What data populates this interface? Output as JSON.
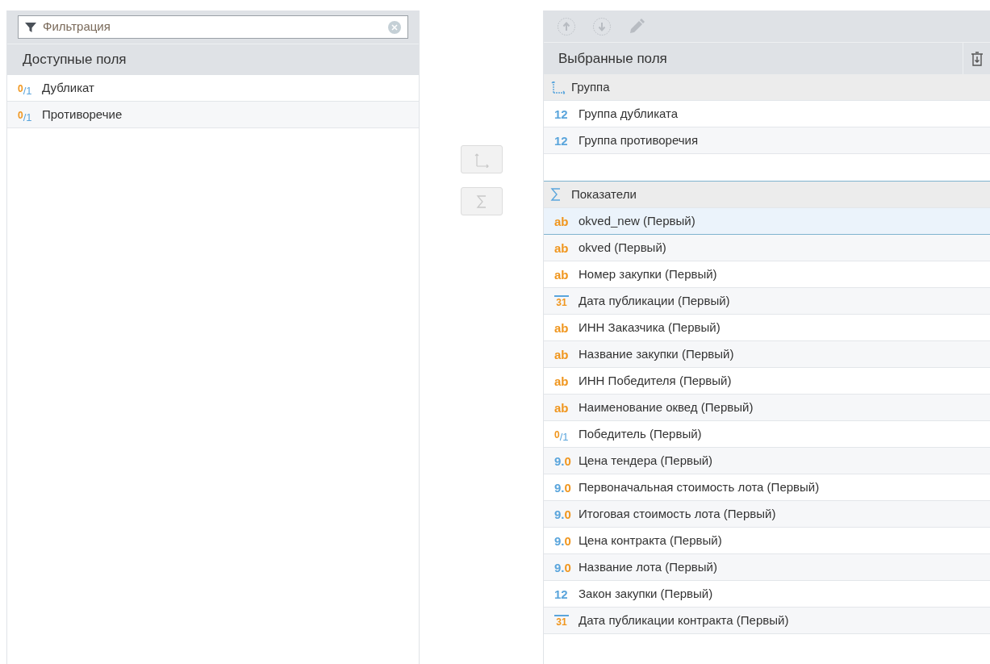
{
  "available": {
    "filter": {
      "placeholder": "Фильтрация"
    },
    "title": "Доступные поля",
    "items": [
      {
        "kind": "boolean",
        "badge": [
          "0",
          "/1"
        ],
        "label": "Дубликат"
      },
      {
        "kind": "boolean",
        "badge": [
          "0",
          "/1"
        ],
        "label": "Противоречие"
      }
    ]
  },
  "selected_fields": {
    "title": "Выбранные поля",
    "sections": [
      {
        "kind": "group",
        "title": "Группа",
        "items": [
          {
            "kind": "number",
            "badge": [
              "12"
            ],
            "label": "Группа дубликата",
            "selected": false
          },
          {
            "kind": "number",
            "badge": [
              "12"
            ],
            "label": "Группа противоречия",
            "selected": false
          }
        ]
      },
      {
        "kind": "measures",
        "title": "Показатели",
        "items": [
          {
            "kind": "string",
            "badge": [
              "ab"
            ],
            "label": "okved_new (Первый)",
            "selected": true
          },
          {
            "kind": "string",
            "badge": [
              "ab"
            ],
            "label": "okved (Первый)",
            "selected": false
          },
          {
            "kind": "string",
            "badge": [
              "ab"
            ],
            "label": "Номер закупки (Первый)",
            "selected": false
          },
          {
            "kind": "date",
            "badge": [
              "31"
            ],
            "label": "Дата публикации (Первый)",
            "selected": false
          },
          {
            "kind": "string",
            "badge": [
              "ab"
            ],
            "label": "ИНН Заказчика (Первый)",
            "selected": false
          },
          {
            "kind": "string",
            "badge": [
              "ab"
            ],
            "label": "Название закупки (Первый)",
            "selected": false
          },
          {
            "kind": "string",
            "badge": [
              "ab"
            ],
            "label": "ИНН Победителя (Первый)",
            "selected": false
          },
          {
            "kind": "string",
            "badge": [
              "ab"
            ],
            "label": "Наименование оквед (Первый)",
            "selected": false
          },
          {
            "kind": "boolean",
            "badge": [
              "0",
              "/1"
            ],
            "label": "Победитель (Первый)",
            "selected": false
          },
          {
            "kind": "float",
            "badge": [
              "9.",
              "0"
            ],
            "label": "Цена тендера (Первый)",
            "selected": false
          },
          {
            "kind": "float",
            "badge": [
              "9.",
              "0"
            ],
            "label": "Первоначальная стоимость лота (Первый)",
            "selected": false
          },
          {
            "kind": "float",
            "badge": [
              "9.",
              "0"
            ],
            "label": "Итоговая стоимость лота (Первый)",
            "selected": false
          },
          {
            "kind": "float",
            "badge": [
              "9.",
              "0"
            ],
            "label": "Цена контракта (Первый)",
            "selected": false
          },
          {
            "kind": "float",
            "badge": [
              "9.",
              "0"
            ],
            "label": "Название лота (Первый)",
            "selected": false
          },
          {
            "kind": "number",
            "badge": [
              "12"
            ],
            "label": "Закон закупки (Первый)",
            "selected": false
          },
          {
            "kind": "date",
            "badge": [
              "31"
            ],
            "label": "Дата публикации контракта (Первый)",
            "selected": false
          }
        ]
      }
    ]
  }
}
